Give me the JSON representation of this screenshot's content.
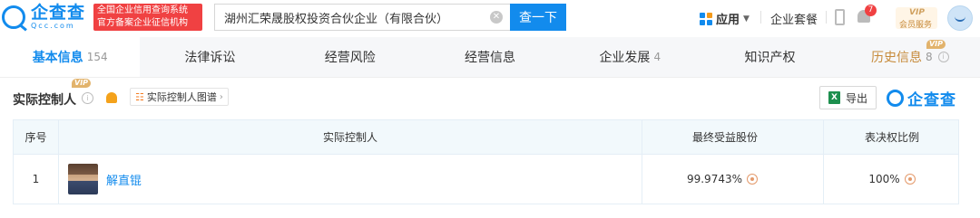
{
  "header": {
    "logo_cn": "企查查",
    "logo_en": "Qcc.com",
    "badge_line1": "全国企业信用查询系统",
    "badge_line2": "官方备案企业征信机构",
    "search_value": "湖州汇荣晟股权投资合伙企业（有限合伙）",
    "search_button": "查一下",
    "app_menu": "应用",
    "suite": "企业套餐",
    "notification_count": "7",
    "vip_label": "VIP",
    "vip_sub": "会员服务"
  },
  "tabs": [
    {
      "label": "基本信息",
      "count": "154"
    },
    {
      "label": "法律诉讼",
      "count": ""
    },
    {
      "label": "经营风险",
      "count": ""
    },
    {
      "label": "经营信息",
      "count": ""
    },
    {
      "label": "企业发展",
      "count": "4"
    },
    {
      "label": "知识产权",
      "count": ""
    },
    {
      "label": "历史信息",
      "count": "8",
      "vip": "VIP"
    }
  ],
  "section": {
    "title": "实际控制人",
    "vip": "VIP",
    "graph_button": "实际控制人图谱",
    "export_button": "导出",
    "brand": "企查查"
  },
  "table": {
    "headers": [
      "序号",
      "实际控制人",
      "最终受益股份",
      "表决权比例"
    ],
    "rows": [
      {
        "index": "1",
        "name": "解直锟",
        "benefit_share": "99.9743%",
        "voting_ratio": "100%"
      }
    ]
  }
}
